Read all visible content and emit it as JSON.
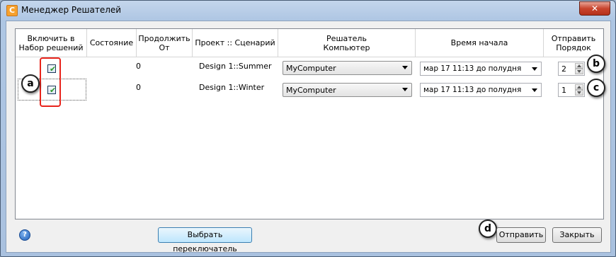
{
  "window": {
    "title": "Менеджер Решателей",
    "app_icon_glyph": "C",
    "close_glyph": "✕"
  },
  "columns": [
    {
      "label": "Включить в\nНабор решений"
    },
    {
      "label": "Состояние"
    },
    {
      "label": "Продолжить\nОт"
    },
    {
      "label": "Проект :: Сценарий"
    },
    {
      "label": "Решатель\nКомпьютер"
    },
    {
      "label": "Время начала"
    },
    {
      "label": "Отправить\nПорядок"
    }
  ],
  "rows": [
    {
      "enabled": true,
      "status": "",
      "continue_from": "0",
      "project_scenario": "Design 1::Summer",
      "computer": "MyComputer",
      "start_time": "мар 17 11:13 до полудня",
      "order": "2"
    },
    {
      "enabled": true,
      "status": "",
      "continue_from": "0",
      "project_scenario": "Design 1::Winter",
      "computer": "MyComputer",
      "start_time": "мар 17 11:13 до полудня",
      "order": "1"
    }
  ],
  "callouts": {
    "a": "a",
    "b": "b",
    "c": "c",
    "d": "d"
  },
  "buttons": {
    "select_toggle": "Выбрать переключатель",
    "submit": "Отправить",
    "close": "Закрыть"
  },
  "help_glyph": "?",
  "checkmark_glyph": "✔"
}
